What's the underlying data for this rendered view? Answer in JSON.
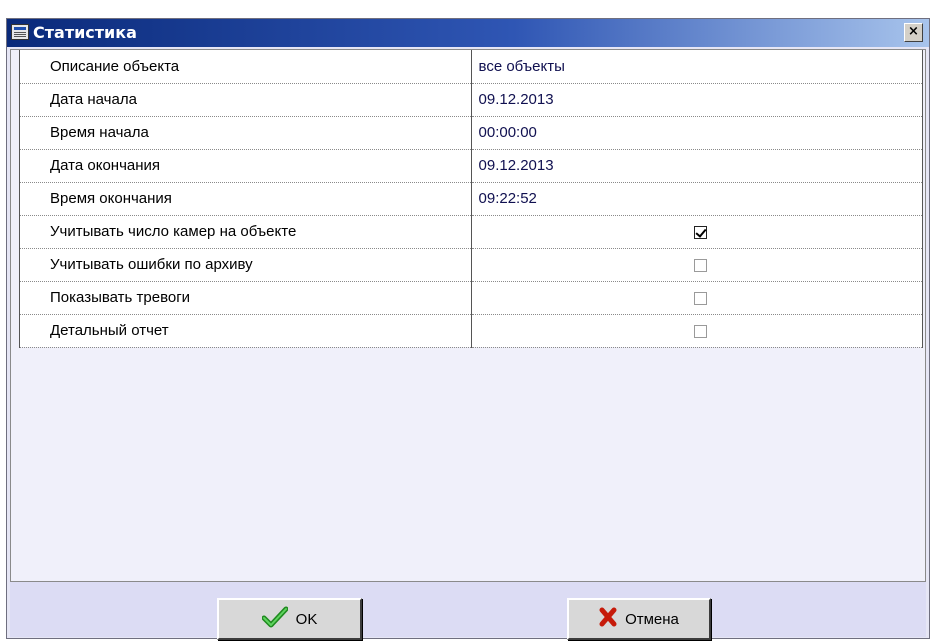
{
  "window": {
    "title": "Статистика",
    "close_glyph": "×"
  },
  "properties": [
    {
      "label": "Описание объекта",
      "value": "все объекты",
      "type": "text"
    },
    {
      "label": "Дата начала",
      "value": "09.12.2013",
      "type": "text"
    },
    {
      "label": "Время начала",
      "value": "00:00:00",
      "type": "text"
    },
    {
      "label": "Дата окончания",
      "value": "09.12.2013",
      "type": "text"
    },
    {
      "label": "Время окончания",
      "value": "09:22:52",
      "type": "text"
    },
    {
      "label": "Учитывать число камер на объекте",
      "checked": true,
      "type": "checkbox"
    },
    {
      "label": "Учитывать ошибки по архиву",
      "checked": false,
      "type": "checkbox"
    },
    {
      "label": "Показывать тревоги",
      "checked": false,
      "type": "checkbox"
    },
    {
      "label": "Детальный отчет",
      "checked": false,
      "type": "checkbox"
    }
  ],
  "buttons": {
    "ok_label": "OK",
    "cancel_label": "Отмена"
  },
  "icons": {
    "title": "statistics-window-icon",
    "ok": "green-checkmark-icon",
    "cancel": "red-x-icon"
  },
  "colors": {
    "title_gradient_start": "#0a2a7a",
    "title_gradient_end": "#a8c4ec",
    "footer_bg": "#dcdcf4",
    "value_text": "#101050"
  }
}
